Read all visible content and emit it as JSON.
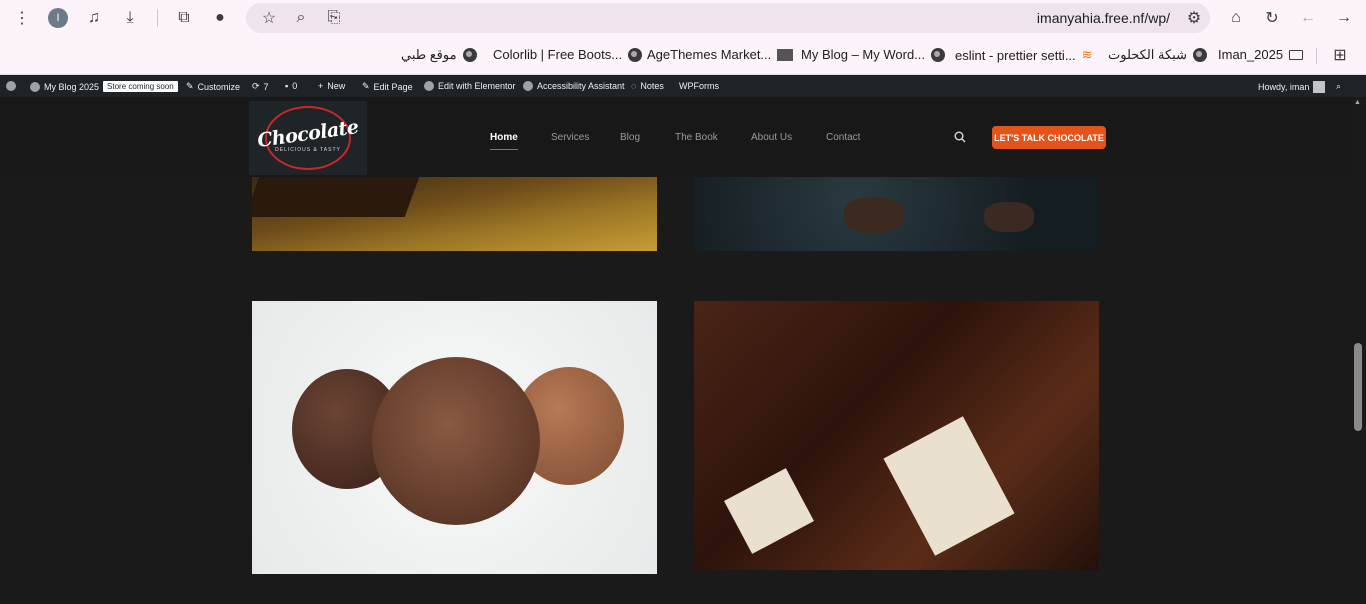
{
  "browser": {
    "profile_initial": "I",
    "url": "imanyahia.free.nf/wp/",
    "bookmarks": [
      "موقع طبي",
      "Colorlib | Free Boots...",
      "AgeThemes Market...",
      "My Blog – My Word...",
      "eslint - prettier setti...",
      "شبكة الكحلوت",
      "Iman_2025"
    ]
  },
  "adminbar": {
    "site": "My Blog 2025",
    "badge": "Store coming soon",
    "customize": "Customize",
    "updates": "7",
    "comments": "0",
    "new": "New",
    "edit_page": "Edit Page",
    "elementor": "Edit with Elementor",
    "accessibility": "Accessibility Assistant",
    "notes": "Notes",
    "wpforms": "WPForms",
    "howdy": "Howdy, iman"
  },
  "header": {
    "logo_word": "Chocolate",
    "logo_sub": "DELICIOUS & TASTY",
    "nav": [
      "Home",
      "Services",
      "Blog",
      "The Book",
      "About Us",
      "Contact"
    ],
    "cta": "LET'S TALK CHOCOLATE"
  },
  "colors": {
    "accent": "#e2541c",
    "page_bg": "#1a1a1a",
    "admin_bg": "#1d2327"
  }
}
